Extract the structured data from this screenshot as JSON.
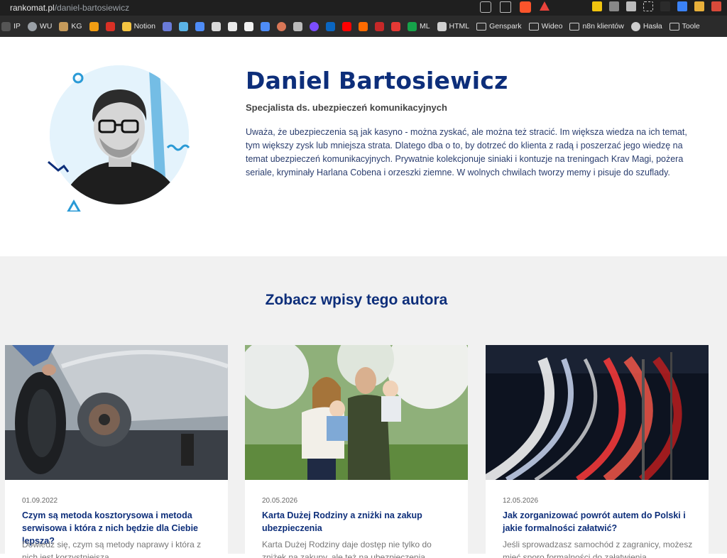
{
  "browser": {
    "url_domain": "rankomat.pl",
    "url_path": "/daniel-bartosiewicz",
    "bookmarks": [
      {
        "label": "IP",
        "icon": "ip-icon"
      },
      {
        "label": "WU",
        "icon": "globe-search-icon"
      },
      {
        "label": "KG",
        "icon": "kg-icon"
      },
      {
        "label": "",
        "icon": "analytics-icon"
      },
      {
        "label": "",
        "icon": "red-badge-icon"
      },
      {
        "label": "Notion",
        "icon": "notion-emoji-icon"
      },
      {
        "label": "",
        "icon": "person-icon"
      },
      {
        "label": "",
        "icon": "swirl-icon"
      },
      {
        "label": "",
        "icon": "gemini-icon"
      },
      {
        "label": "",
        "icon": "openai-icon"
      },
      {
        "label": "",
        "icon": "openai-dark-icon"
      },
      {
        "label": "",
        "icon": "terminal-icon"
      },
      {
        "label": "",
        "icon": "sparkle-icon"
      },
      {
        "label": "",
        "icon": "claude-icon"
      },
      {
        "label": "",
        "icon": "copilot-icon"
      },
      {
        "label": "",
        "icon": "purple-circle-icon"
      },
      {
        "label": "",
        "icon": "linkedin-icon"
      },
      {
        "label": "",
        "icon": "youtube-icon"
      },
      {
        "label": "",
        "icon": "a-letter-icon"
      },
      {
        "label": "",
        "icon": "im-icon"
      },
      {
        "label": "",
        "icon": "calendar-icon"
      },
      {
        "label": "ML",
        "icon": "chat-icon"
      },
      {
        "label": "HTML",
        "icon": "pen-icon"
      },
      {
        "label": "Genspark",
        "icon": "folder-icon"
      },
      {
        "label": "Wideo",
        "icon": "folder-icon"
      },
      {
        "label": "n8n klientów",
        "icon": "folder-icon"
      },
      {
        "label": "Hasła",
        "icon": "globe-icon"
      },
      {
        "label": "Toole",
        "icon": "folder-icon"
      }
    ]
  },
  "author": {
    "name": "Daniel Bartosiewicz",
    "role": "Specjalista ds. ubezpieczeń komunikacyjnych",
    "bio": "Uważa, że ubezpieczenia są jak kasyno - można zyskać, ale można też stracić. Im większa wiedza na ich temat, tym większy zysk lub mniejsza strata. Dlatego dba o to, by dotrzeć do klienta z radą i poszerzać jego wiedzę na temat ubezpieczeń komunikacyjnych.  Prywatnie kolekcjonuje siniaki i kontuzje na treningach Krav Magi, pożera seriale, kryminały Harlana Cobena i orzeszki ziemne. W wolnych chwilach tworzy memy i pisuje do szuflady."
  },
  "posts": {
    "heading": "Zobacz wpisy tego autora",
    "cards": [
      {
        "date": "01.09.2022",
        "title": "Czym są metoda kosztorysowa i metoda serwisowa i która z nich będzie dla Ciebie lepsza?",
        "excerpt": "Dowiedz się, czym są metody naprawy i która z nich jest korzystniejsza.",
        "image": "car-wheel-repair-photo"
      },
      {
        "date": "20.05.2026",
        "title": "Karta Dużej Rodziny a zniżki na zakup ubezpieczenia",
        "excerpt": "Karta Dużej Rodziny daje dostęp nie tylko do zniżek na zakupy, ale też na ubezpieczenia.",
        "image": "family-in-orchard-photo"
      },
      {
        "date": "12.05.2026",
        "title": "Jak zorganizować powrót autem do Polski i jakie formalności załatwić?",
        "excerpt": "Jeśli sprowadzasz samochód z zagranicy, możesz mieć sporo formalności do załatwienia.",
        "image": "night-highway-light-trails-photo"
      }
    ]
  }
}
